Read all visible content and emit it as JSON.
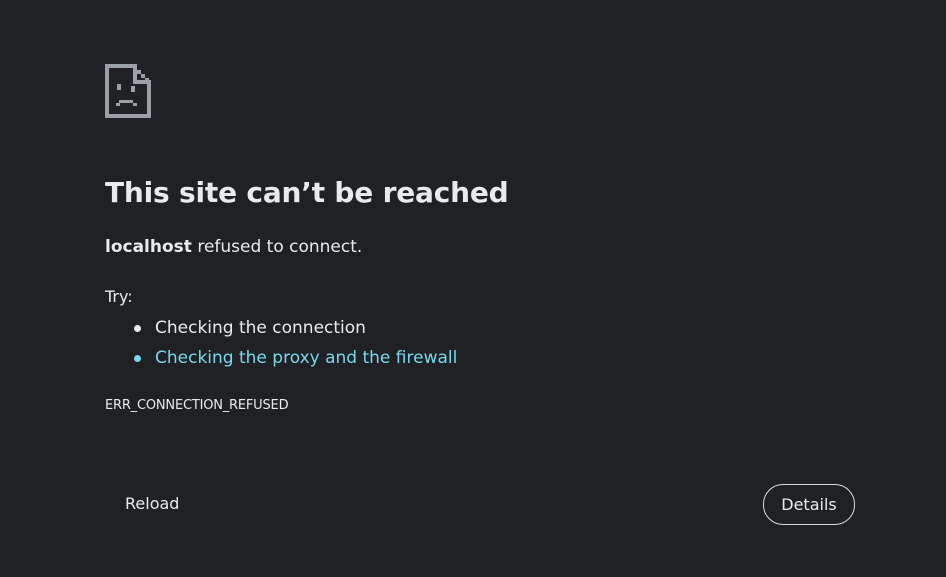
{
  "icon": "sad-page-icon",
  "heading": "This site can’t be reached",
  "summary": {
    "host": "localhost",
    "message": " refused to connect."
  },
  "suggestions": {
    "label": "Try:",
    "items": [
      {
        "text": "Checking the connection",
        "is_link": false
      },
      {
        "text": "Checking the proxy and the firewall",
        "is_link": true
      }
    ]
  },
  "error_code": "ERR_CONNECTION_REFUSED",
  "buttons": {
    "reload": "Reload",
    "details": "Details"
  },
  "colors": {
    "background": "#202124",
    "text": "#e8eaed",
    "link": "#78d9ec"
  }
}
